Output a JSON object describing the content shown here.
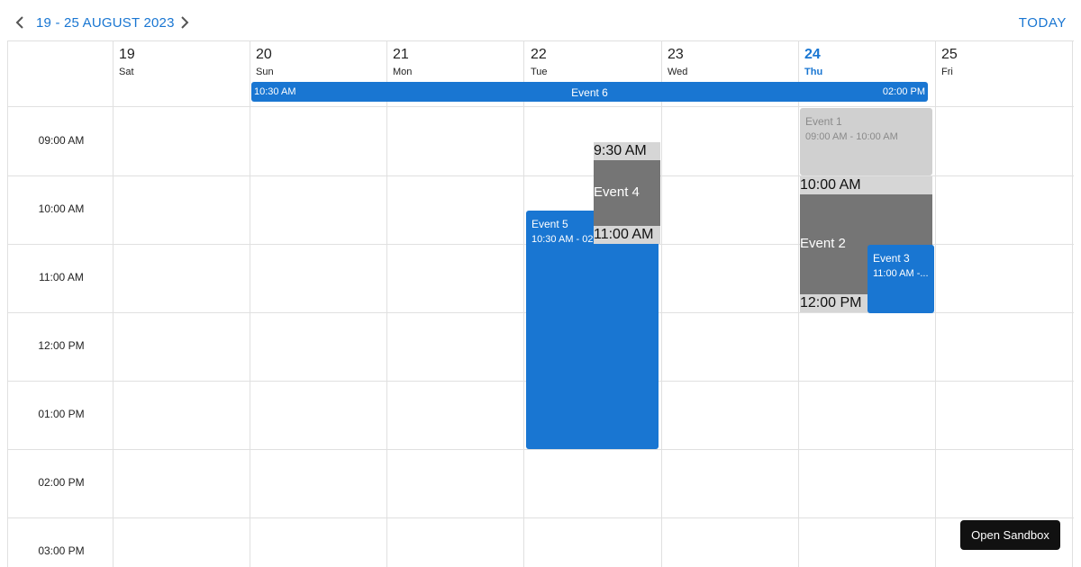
{
  "toolbar": {
    "range_label": "19 - 25 AUGUST 2023",
    "today_label": "TODAY"
  },
  "days": [
    {
      "num": "19",
      "name": "Sat"
    },
    {
      "num": "20",
      "name": "Sun"
    },
    {
      "num": "21",
      "name": "Mon"
    },
    {
      "num": "22",
      "name": "Tue"
    },
    {
      "num": "23",
      "name": "Wed"
    },
    {
      "num": "24",
      "name": "Thu",
      "is_today": true
    },
    {
      "num": "25",
      "name": "Fri"
    }
  ],
  "hours": [
    "09:00 AM",
    "10:00 AM",
    "11:00 AM",
    "12:00 PM",
    "01:00 PM",
    "02:00 PM",
    "03:00 PM"
  ],
  "allday_event": {
    "title": "Event 6",
    "start": "10:30 AM",
    "end": "02:00 PM"
  },
  "events": {
    "event1": {
      "title": "Event 1",
      "time": "09:00 AM - 10:00 AM"
    },
    "event3": {
      "title": "Event 3",
      "time": "11:00 AM -..."
    },
    "event5": {
      "title": "Event 5",
      "time": "10:30 AM - 02:00 PM"
    }
  },
  "drag_previews": {
    "event4": {
      "title": "Event 4",
      "start": "9:30 AM",
      "end": "11:00 AM"
    },
    "event2": {
      "title": "Event 2",
      "start": "10:00 AM",
      "end": "12:00 PM"
    }
  },
  "sandbox_button": "Open Sandbox",
  "colors": {
    "accent": "#1976d2",
    "drag_body": "#757575",
    "drag_slot": "#d6d6d6",
    "event_light": "#d0d0d0"
  }
}
